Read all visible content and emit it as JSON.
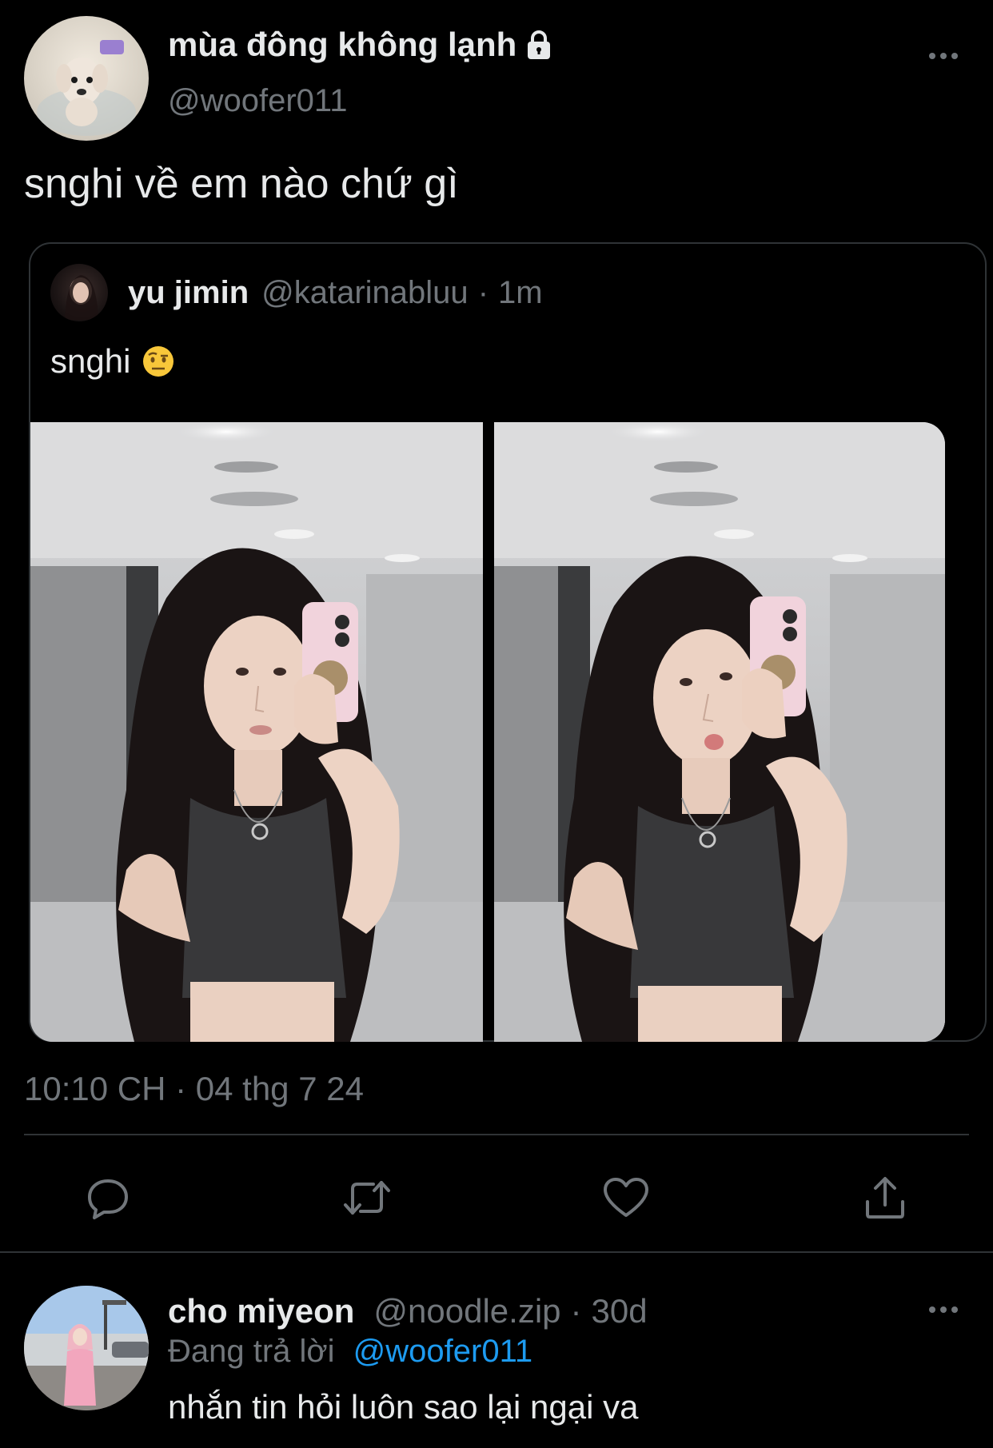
{
  "colors": {
    "background": "#000000",
    "text_primary": "#e7e9ea",
    "text_secondary": "#71767b",
    "border": "#2f3336",
    "link": "#1d9bf0"
  },
  "tweet": {
    "author_name": "mùa đông không lạnh",
    "author_handle": "@woofer011",
    "protected_icon": "lock-icon",
    "text": "snghi về em nào chứ gì",
    "timestamp": "10:10 CH · 04 thg 7 24"
  },
  "quoted_tweet": {
    "author_name": "yu jimin",
    "author_handle": "@katarinabluu",
    "separator": "·",
    "time": "1m",
    "text": "snghi",
    "emoji": "raised-eyebrow-emoji",
    "images": [
      {
        "icon": "mirror-selfie-photo"
      },
      {
        "icon": "mirror-selfie-photo"
      }
    ]
  },
  "actions": {
    "reply": "reply-icon",
    "retweet": "retweet-icon",
    "like": "heart-icon",
    "share": "share-icon"
  },
  "reply": {
    "author_name": "cho miyeon",
    "author_handle": "@noodle.zip",
    "separator": "·",
    "time": "30d",
    "replying_label": "Đang trả lời",
    "replying_mention": "@woofer011",
    "text": "nhắn tin hỏi luôn sao lại ngại va"
  }
}
